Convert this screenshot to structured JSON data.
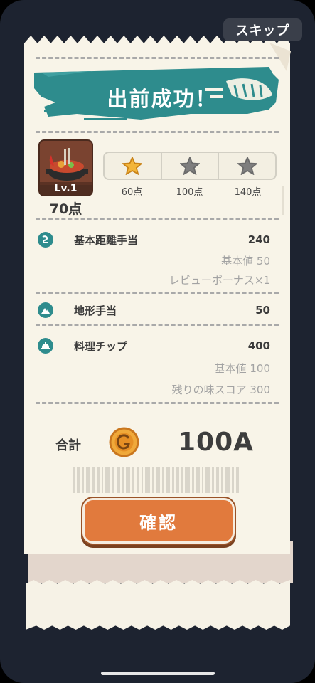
{
  "skip_button": "スキップ",
  "banner": {
    "title": "出前成功！",
    "accent_color": "#2e8c8d"
  },
  "dish": {
    "level": "Lv.1",
    "score": "70点"
  },
  "stars": [
    {
      "label": "60点",
      "filled": true
    },
    {
      "label": "100点",
      "filled": false
    },
    {
      "label": "140点",
      "filled": false
    }
  ],
  "rows": [
    {
      "icon": "distance-icon",
      "title": "基本距離手当",
      "value": "240",
      "subs": [
        "基本値 50",
        "レビューボーナス×1"
      ]
    },
    {
      "icon": "terrain-icon",
      "title": "地形手当",
      "value": "50",
      "subs": []
    },
    {
      "icon": "cloche-icon",
      "title": "料理チップ",
      "value": "400",
      "subs": [
        "基本値 100",
        "残りの味スコア 300"
      ]
    }
  ],
  "total": {
    "label": "合計",
    "value": "100A",
    "icon": "coin-icon"
  },
  "confirm_button": "確認",
  "colors": {
    "orange": "#e17a3d",
    "teal": "#2e8c8d",
    "paper": "#f8f4e8",
    "background": "#1d2330"
  }
}
